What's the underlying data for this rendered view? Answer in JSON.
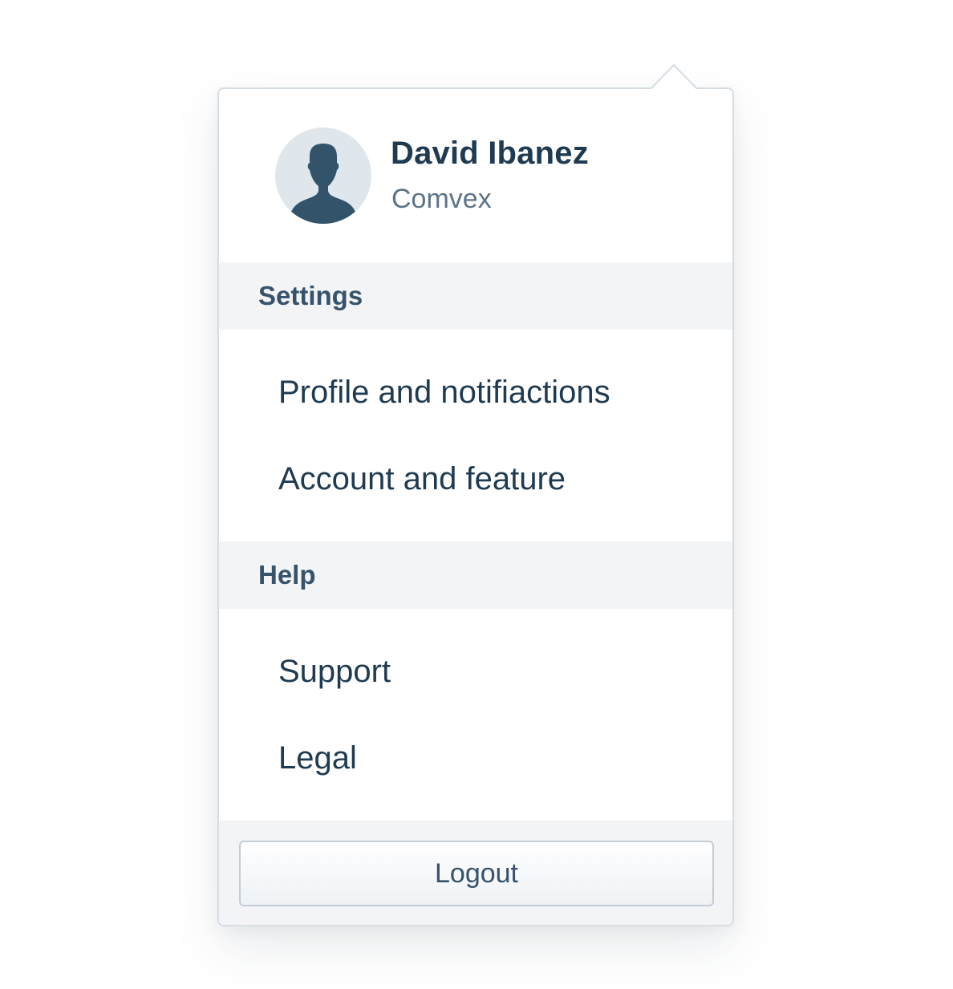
{
  "user": {
    "name": "David Ibanez",
    "organization": "Comvex",
    "avatar_icon": "person-silhouette-icon"
  },
  "sections": {
    "settings": {
      "title": "Settings",
      "items": [
        "Profile and notifiactions",
        "Account and feature"
      ]
    },
    "help": {
      "title": "Help",
      "items": [
        "Support",
        "Legal"
      ]
    }
  },
  "footer": {
    "logout_label": "Logout"
  },
  "colors": {
    "text_primary": "#1f3b52",
    "text_secondary": "#5d7487",
    "section_text": "#37536b",
    "section_bg": "#f2f4f6",
    "border": "#d6dee5",
    "avatar_bg": "#dfe7ec",
    "avatar_figure": "#33536b"
  }
}
